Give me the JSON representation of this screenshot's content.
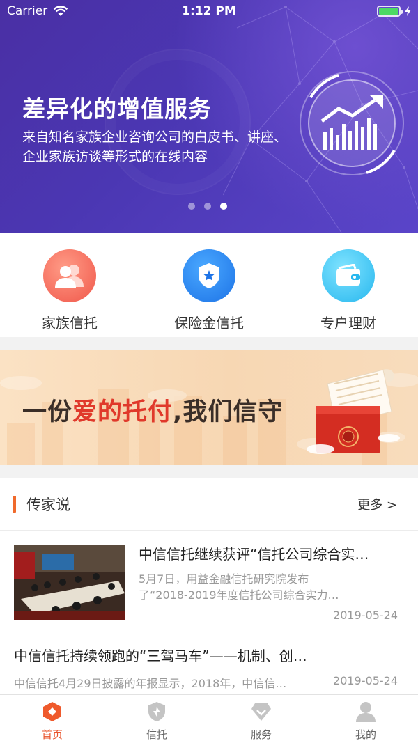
{
  "status_bar": {
    "carrier": "Carrier",
    "time": "1:12 PM",
    "battery_level": 1.0
  },
  "hero": {
    "title": "差异化的增值服务",
    "subtitle": "来自知名家族企业咨询公司的白皮书、讲座、企业家族访谈等形式的在线内容",
    "slide_count": 3,
    "active_slide": 3
  },
  "quick_menu": [
    {
      "label": "家族信托",
      "icon": "family-users-icon"
    },
    {
      "label": "保险金信托",
      "icon": "shield-star-icon"
    },
    {
      "label": "专户理财",
      "icon": "wallet-icon"
    }
  ],
  "promo": {
    "text_pre": "一份",
    "text_highlight": "爱的托付",
    "text_post": ",我们信守"
  },
  "news": {
    "section_title": "传家说",
    "more_label": "更多 >",
    "articles": [
      {
        "title": "中信信托继续获评“信托公司综合实…",
        "summary": "5月7日，用益金融信托研究院发布了“2018-2019年度信托公司综合实力…",
        "date": "2019-05-24"
      },
      {
        "title": "中信信托持续领跑的“三驾马车”——机制、创…",
        "summary": "中信信托4月29日披露的年报显示，2018年，中信信…",
        "date": "2019-05-24"
      }
    ]
  },
  "tabbar": [
    {
      "label": "首页",
      "icon": "home-hexagon-icon",
      "active": true
    },
    {
      "label": "信托",
      "icon": "shield-icon",
      "active": false
    },
    {
      "label": "服务",
      "icon": "diamond-icon",
      "active": false
    },
    {
      "label": "我的",
      "icon": "user-icon",
      "active": false
    }
  ],
  "colors": {
    "hero_gradient": [
      "#4a2fa4",
      "#5a45c9"
    ],
    "accent": "#e8532b",
    "section_bar": "#f06a2c",
    "promo_highlight": "#e0392b"
  }
}
